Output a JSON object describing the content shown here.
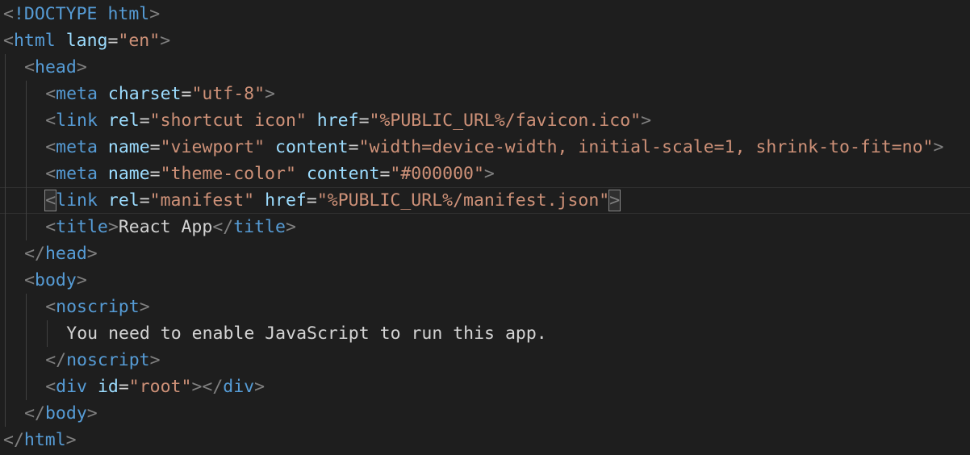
{
  "editor": {
    "lines": [
      {
        "indent": 0,
        "tokens": [
          [
            "bracket",
            "<"
          ],
          [
            "tag",
            "!DOCTYPE"
          ],
          [
            "text",
            " "
          ],
          [
            "tag",
            "html"
          ],
          [
            "bracket",
            ">"
          ]
        ]
      },
      {
        "indent": 0,
        "tokens": [
          [
            "bracket",
            "<"
          ],
          [
            "tag",
            "html"
          ],
          [
            "text",
            " "
          ],
          [
            "attr",
            "lang"
          ],
          [
            "eq",
            "="
          ],
          [
            "str",
            "\"en\""
          ],
          [
            "bracket",
            ">"
          ]
        ]
      },
      {
        "indent": 1,
        "tokens": [
          [
            "bracket",
            "<"
          ],
          [
            "tag",
            "head"
          ],
          [
            "bracket",
            ">"
          ]
        ]
      },
      {
        "indent": 2,
        "tokens": [
          [
            "bracket",
            "<"
          ],
          [
            "tag",
            "meta"
          ],
          [
            "text",
            " "
          ],
          [
            "attr",
            "charset"
          ],
          [
            "eq",
            "="
          ],
          [
            "str",
            "\"utf-8\""
          ],
          [
            "bracket",
            ">"
          ]
        ]
      },
      {
        "indent": 2,
        "tokens": [
          [
            "bracket",
            "<"
          ],
          [
            "tag",
            "link"
          ],
          [
            "text",
            " "
          ],
          [
            "attr",
            "rel"
          ],
          [
            "eq",
            "="
          ],
          [
            "str",
            "\"shortcut icon\""
          ],
          [
            "text",
            " "
          ],
          [
            "attr",
            "href"
          ],
          [
            "eq",
            "="
          ],
          [
            "str",
            "\"%PUBLIC_URL%/favicon.ico\""
          ],
          [
            "bracket",
            ">"
          ]
        ]
      },
      {
        "indent": 2,
        "tokens": [
          [
            "bracket",
            "<"
          ],
          [
            "tag",
            "meta"
          ],
          [
            "text",
            " "
          ],
          [
            "attr",
            "name"
          ],
          [
            "eq",
            "="
          ],
          [
            "str",
            "\"viewport\""
          ],
          [
            "text",
            " "
          ],
          [
            "attr",
            "content"
          ],
          [
            "eq",
            "="
          ],
          [
            "str",
            "\"width=device-width, initial-scale=1, shrink-to-fit=no\""
          ],
          [
            "bracket",
            ">"
          ]
        ]
      },
      {
        "indent": 2,
        "tokens": [
          [
            "bracket",
            "<"
          ],
          [
            "tag",
            "meta"
          ],
          [
            "text",
            " "
          ],
          [
            "attr",
            "name"
          ],
          [
            "eq",
            "="
          ],
          [
            "str",
            "\"theme-color\""
          ],
          [
            "text",
            " "
          ],
          [
            "attr",
            "content"
          ],
          [
            "eq",
            "="
          ],
          [
            "str",
            "\"#000000\""
          ],
          [
            "bracket",
            ">"
          ]
        ]
      },
      {
        "indent": 2,
        "current": true,
        "tokens": [
          [
            "bracket-match",
            "<"
          ],
          [
            "tag",
            "link"
          ],
          [
            "text",
            " "
          ],
          [
            "attr",
            "rel"
          ],
          [
            "eq",
            "="
          ],
          [
            "str",
            "\"manifest\""
          ],
          [
            "text",
            " "
          ],
          [
            "attr",
            "href"
          ],
          [
            "eq",
            "="
          ],
          [
            "str",
            "\"%PUBLIC_URL%/manifest.json\""
          ],
          [
            "bracket-match",
            ">"
          ]
        ]
      },
      {
        "indent": 2,
        "tokens": [
          [
            "bracket",
            "<"
          ],
          [
            "tag",
            "title"
          ],
          [
            "bracket",
            ">"
          ],
          [
            "text",
            "React App"
          ],
          [
            "bracket",
            "</"
          ],
          [
            "tag",
            "title"
          ],
          [
            "bracket",
            ">"
          ]
        ]
      },
      {
        "indent": 1,
        "tokens": [
          [
            "bracket",
            "</"
          ],
          [
            "tag",
            "head"
          ],
          [
            "bracket",
            ">"
          ]
        ]
      },
      {
        "indent": 1,
        "tokens": [
          [
            "bracket",
            "<"
          ],
          [
            "tag",
            "body"
          ],
          [
            "bracket",
            ">"
          ]
        ]
      },
      {
        "indent": 2,
        "tokens": [
          [
            "bracket",
            "<"
          ],
          [
            "tag",
            "noscript"
          ],
          [
            "bracket",
            ">"
          ]
        ]
      },
      {
        "indent": 3,
        "tokens": [
          [
            "text",
            "You need to enable JavaScript to run this app."
          ]
        ]
      },
      {
        "indent": 2,
        "tokens": [
          [
            "bracket",
            "</"
          ],
          [
            "tag",
            "noscript"
          ],
          [
            "bracket",
            ">"
          ]
        ]
      },
      {
        "indent": 2,
        "tokens": [
          [
            "bracket",
            "<"
          ],
          [
            "tag",
            "div"
          ],
          [
            "text",
            " "
          ],
          [
            "attr",
            "id"
          ],
          [
            "eq",
            "="
          ],
          [
            "str",
            "\"root\""
          ],
          [
            "bracket",
            "></"
          ],
          [
            "tag",
            "div"
          ],
          [
            "bracket",
            ">"
          ]
        ]
      },
      {
        "indent": 1,
        "tokens": [
          [
            "bracket",
            "</"
          ],
          [
            "tag",
            "body"
          ],
          [
            "bracket",
            ">"
          ]
        ]
      },
      {
        "indent": 0,
        "tokens": [
          [
            "bracket",
            "</"
          ],
          [
            "tag",
            "html"
          ],
          [
            "bracket",
            ">"
          ]
        ]
      }
    ]
  }
}
